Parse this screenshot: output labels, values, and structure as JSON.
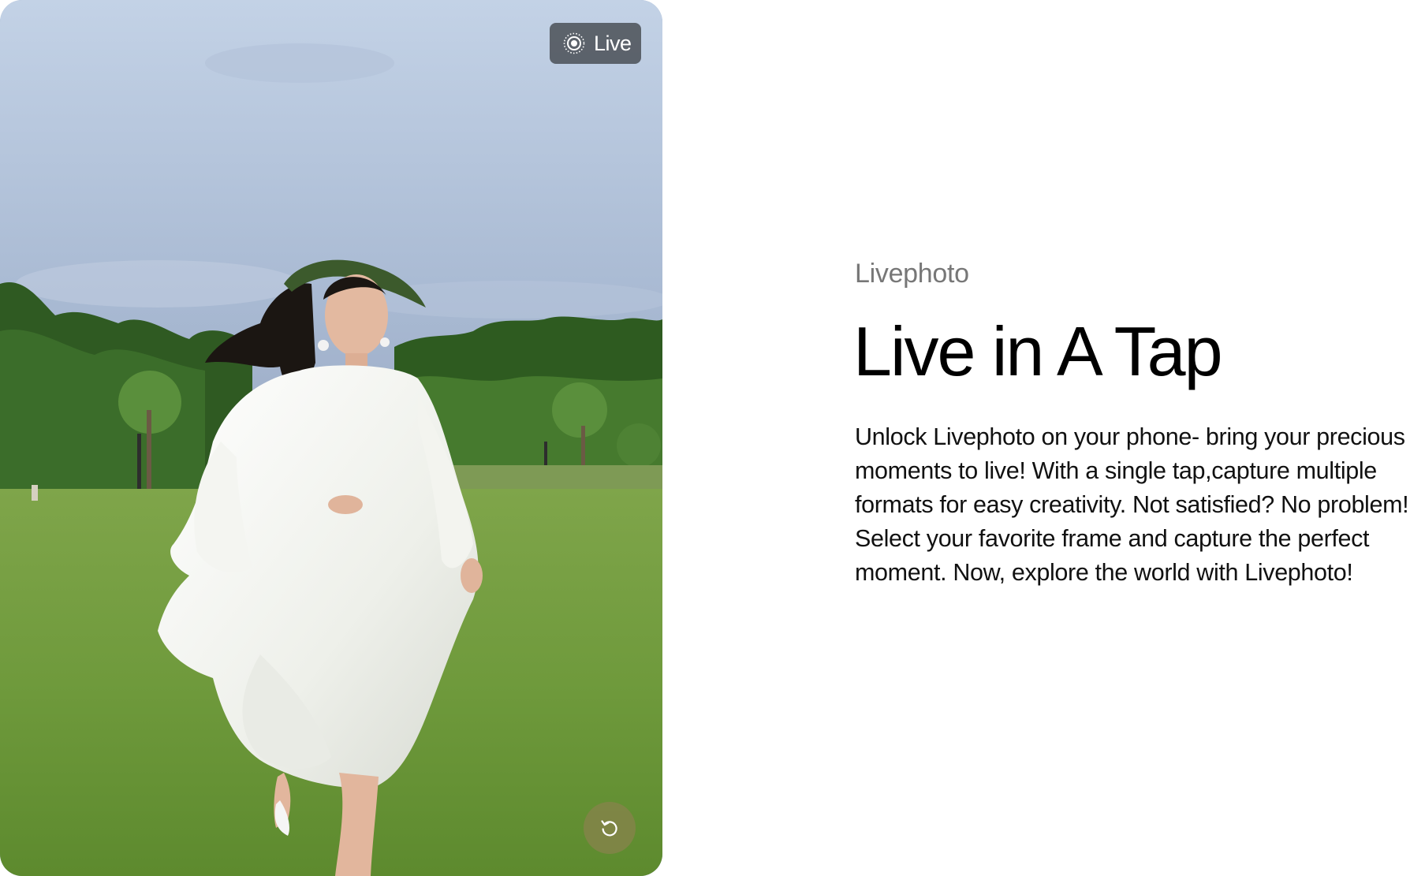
{
  "media": {
    "badge_label": "Live",
    "badge_icon": "live-photo-icon",
    "replay_icon": "replay-icon",
    "replay_button_color": "#828448"
  },
  "content": {
    "eyebrow": "Livephoto",
    "headline": "Live in A Tap",
    "description": "Unlock Livephoto on your phone- bring your precious moments to live! With a single tap,capture multiple formats for easy creativity. Not satisfied? No problem! Select your favorite frame and capture the perfect moment. Now, explore the world with Livephoto!"
  },
  "colors": {
    "headline": "#000000",
    "eyebrow": "#777777",
    "body_text": "#111111",
    "badge_background": "#464a50"
  }
}
